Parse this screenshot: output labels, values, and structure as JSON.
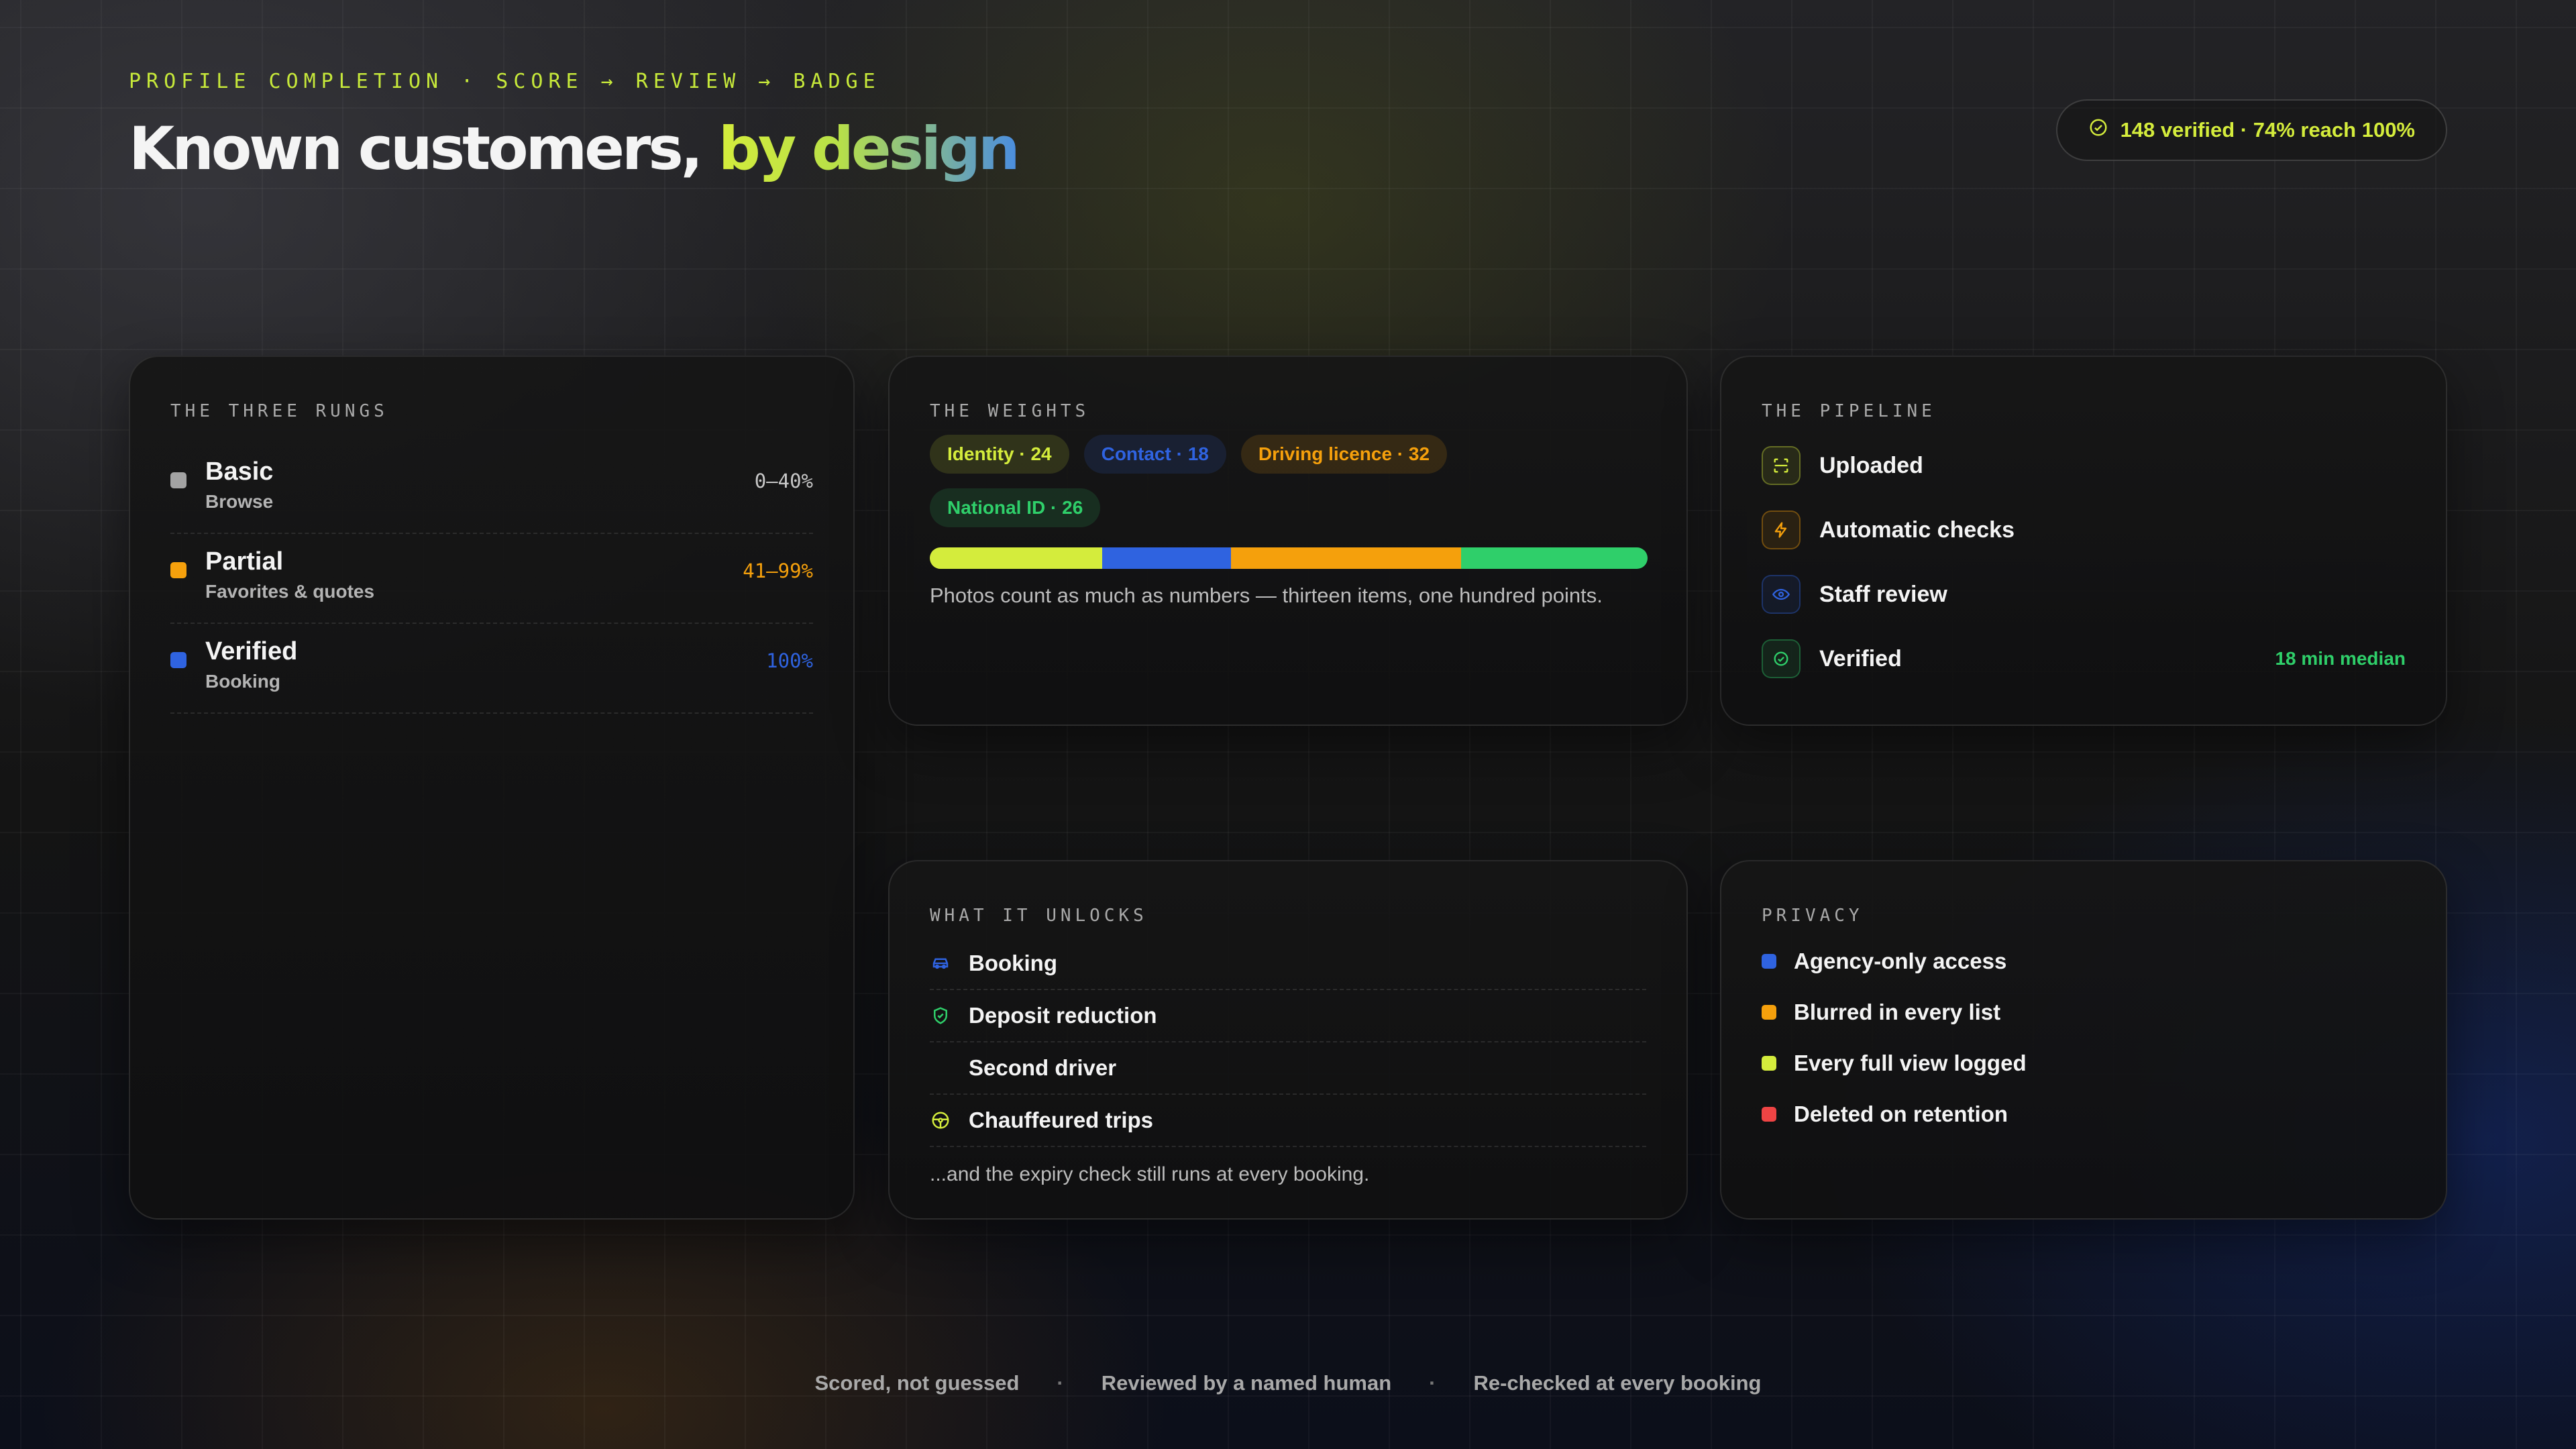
{
  "header": {
    "eyebrow": "PROFILE COMPLETION · SCORE → REVIEW → BADGE",
    "title_main": "Known customers, ",
    "title_accent": "by design",
    "status_pill": "148 verified · 74% reach 100%"
  },
  "colors": {
    "lime": "#d4ec3c",
    "blue": "#2f63e0",
    "orange": "#f5a00c",
    "green": "#2fcf6a",
    "red": "#ef4444",
    "gray": "#a3a3a3"
  },
  "rungs": {
    "label": "THE THREE RUNGS",
    "items": [
      {
        "name": "Basic",
        "sub": "Browse",
        "range": "0–40%",
        "color": "#a3a3a3"
      },
      {
        "name": "Partial",
        "sub": "Favorites & quotes",
        "range": "41–99%",
        "color": "#f5a00c"
      },
      {
        "name": "Verified",
        "sub": "Booking",
        "range": "100%",
        "color": "#2f63e0"
      }
    ]
  },
  "weights": {
    "label": "THE WEIGHTS",
    "chips": [
      {
        "text": "Identity · 24",
        "value": 24,
        "color": "#d4ec3c"
      },
      {
        "text": "Contact · 18",
        "value": 18,
        "color": "#2f63e0"
      },
      {
        "text": "Driving licence · 32",
        "value": 32,
        "color": "#f5a00c"
      },
      {
        "text": "National ID · 26",
        "value": 26,
        "color": "#2fcf6a"
      }
    ],
    "note": "Photos count as much as numbers — thirteen items, one hundred points."
  },
  "pipeline": {
    "label": "THE PIPELINE",
    "steps": [
      {
        "label": "Uploaded",
        "icon": "scan-icon",
        "color": "#d4ec3c"
      },
      {
        "label": "Automatic checks",
        "icon": "lightning-icon",
        "color": "#f5a00c"
      },
      {
        "label": "Staff review",
        "icon": "eye-icon",
        "color": "#2f63e0"
      },
      {
        "label": "Verified",
        "icon": "check-circle-icon",
        "color": "#2fcf6a",
        "aside": "18 min median"
      }
    ]
  },
  "unlocks": {
    "label": "WHAT IT UNLOCKS",
    "items": [
      {
        "label": "Booking",
        "icon": "car-icon"
      },
      {
        "label": "Deposit reduction",
        "icon": "shield-check-icon"
      },
      {
        "label": "Second driver",
        "icon": ""
      },
      {
        "label": "Chauffeured trips",
        "icon": "steering-wheel-icon"
      }
    ],
    "note": "...and the expiry check still runs at every booking."
  },
  "privacy": {
    "label": "PRIVACY",
    "items": [
      {
        "label": "Agency-only access",
        "color": "#2f63e0"
      },
      {
        "label": "Blurred in every list",
        "color": "#f5a00c"
      },
      {
        "label": "Every full view logged",
        "color": "#d4ec3c"
      },
      {
        "label": "Deleted on retention",
        "color": "#ef4444"
      }
    ]
  },
  "footer": {
    "items": [
      "Scored, not guessed",
      "Reviewed by a named human",
      "Re-checked at every booking"
    ],
    "separator": "·"
  }
}
